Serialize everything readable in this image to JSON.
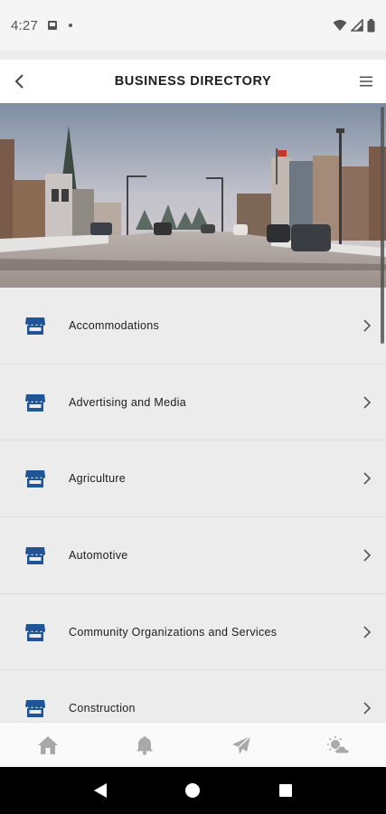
{
  "status_bar": {
    "time": "4:27",
    "icons": [
      "photo-notification-icon",
      "dot-icon",
      "wifi-icon",
      "signal-icon",
      "battery-icon"
    ]
  },
  "header": {
    "title": "BUSINESS DIRECTORY",
    "back_icon": "chevron-left-icon",
    "menu_icon": "hamburger-menu-icon"
  },
  "hero": {
    "image": "main-street-winter-photo"
  },
  "categories": [
    {
      "label": "Accommodations",
      "icon": "storefront-icon"
    },
    {
      "label": "Advertising and Media",
      "icon": "storefront-icon"
    },
    {
      "label": "Agriculture",
      "icon": "storefront-icon"
    },
    {
      "label": "Automotive",
      "icon": "storefront-icon"
    },
    {
      "label": "Community Organizations and Services",
      "icon": "storefront-icon"
    },
    {
      "label": "Construction",
      "icon": "storefront-icon"
    }
  ],
  "bottom_nav": {
    "tabs": [
      {
        "icon": "home-icon"
      },
      {
        "icon": "bell-icon"
      },
      {
        "icon": "send-icon"
      },
      {
        "icon": "weather-icon"
      }
    ]
  },
  "colors": {
    "accent": "#1f5596",
    "icon_gray": "#a9a9a9",
    "list_background": "#ececec"
  }
}
